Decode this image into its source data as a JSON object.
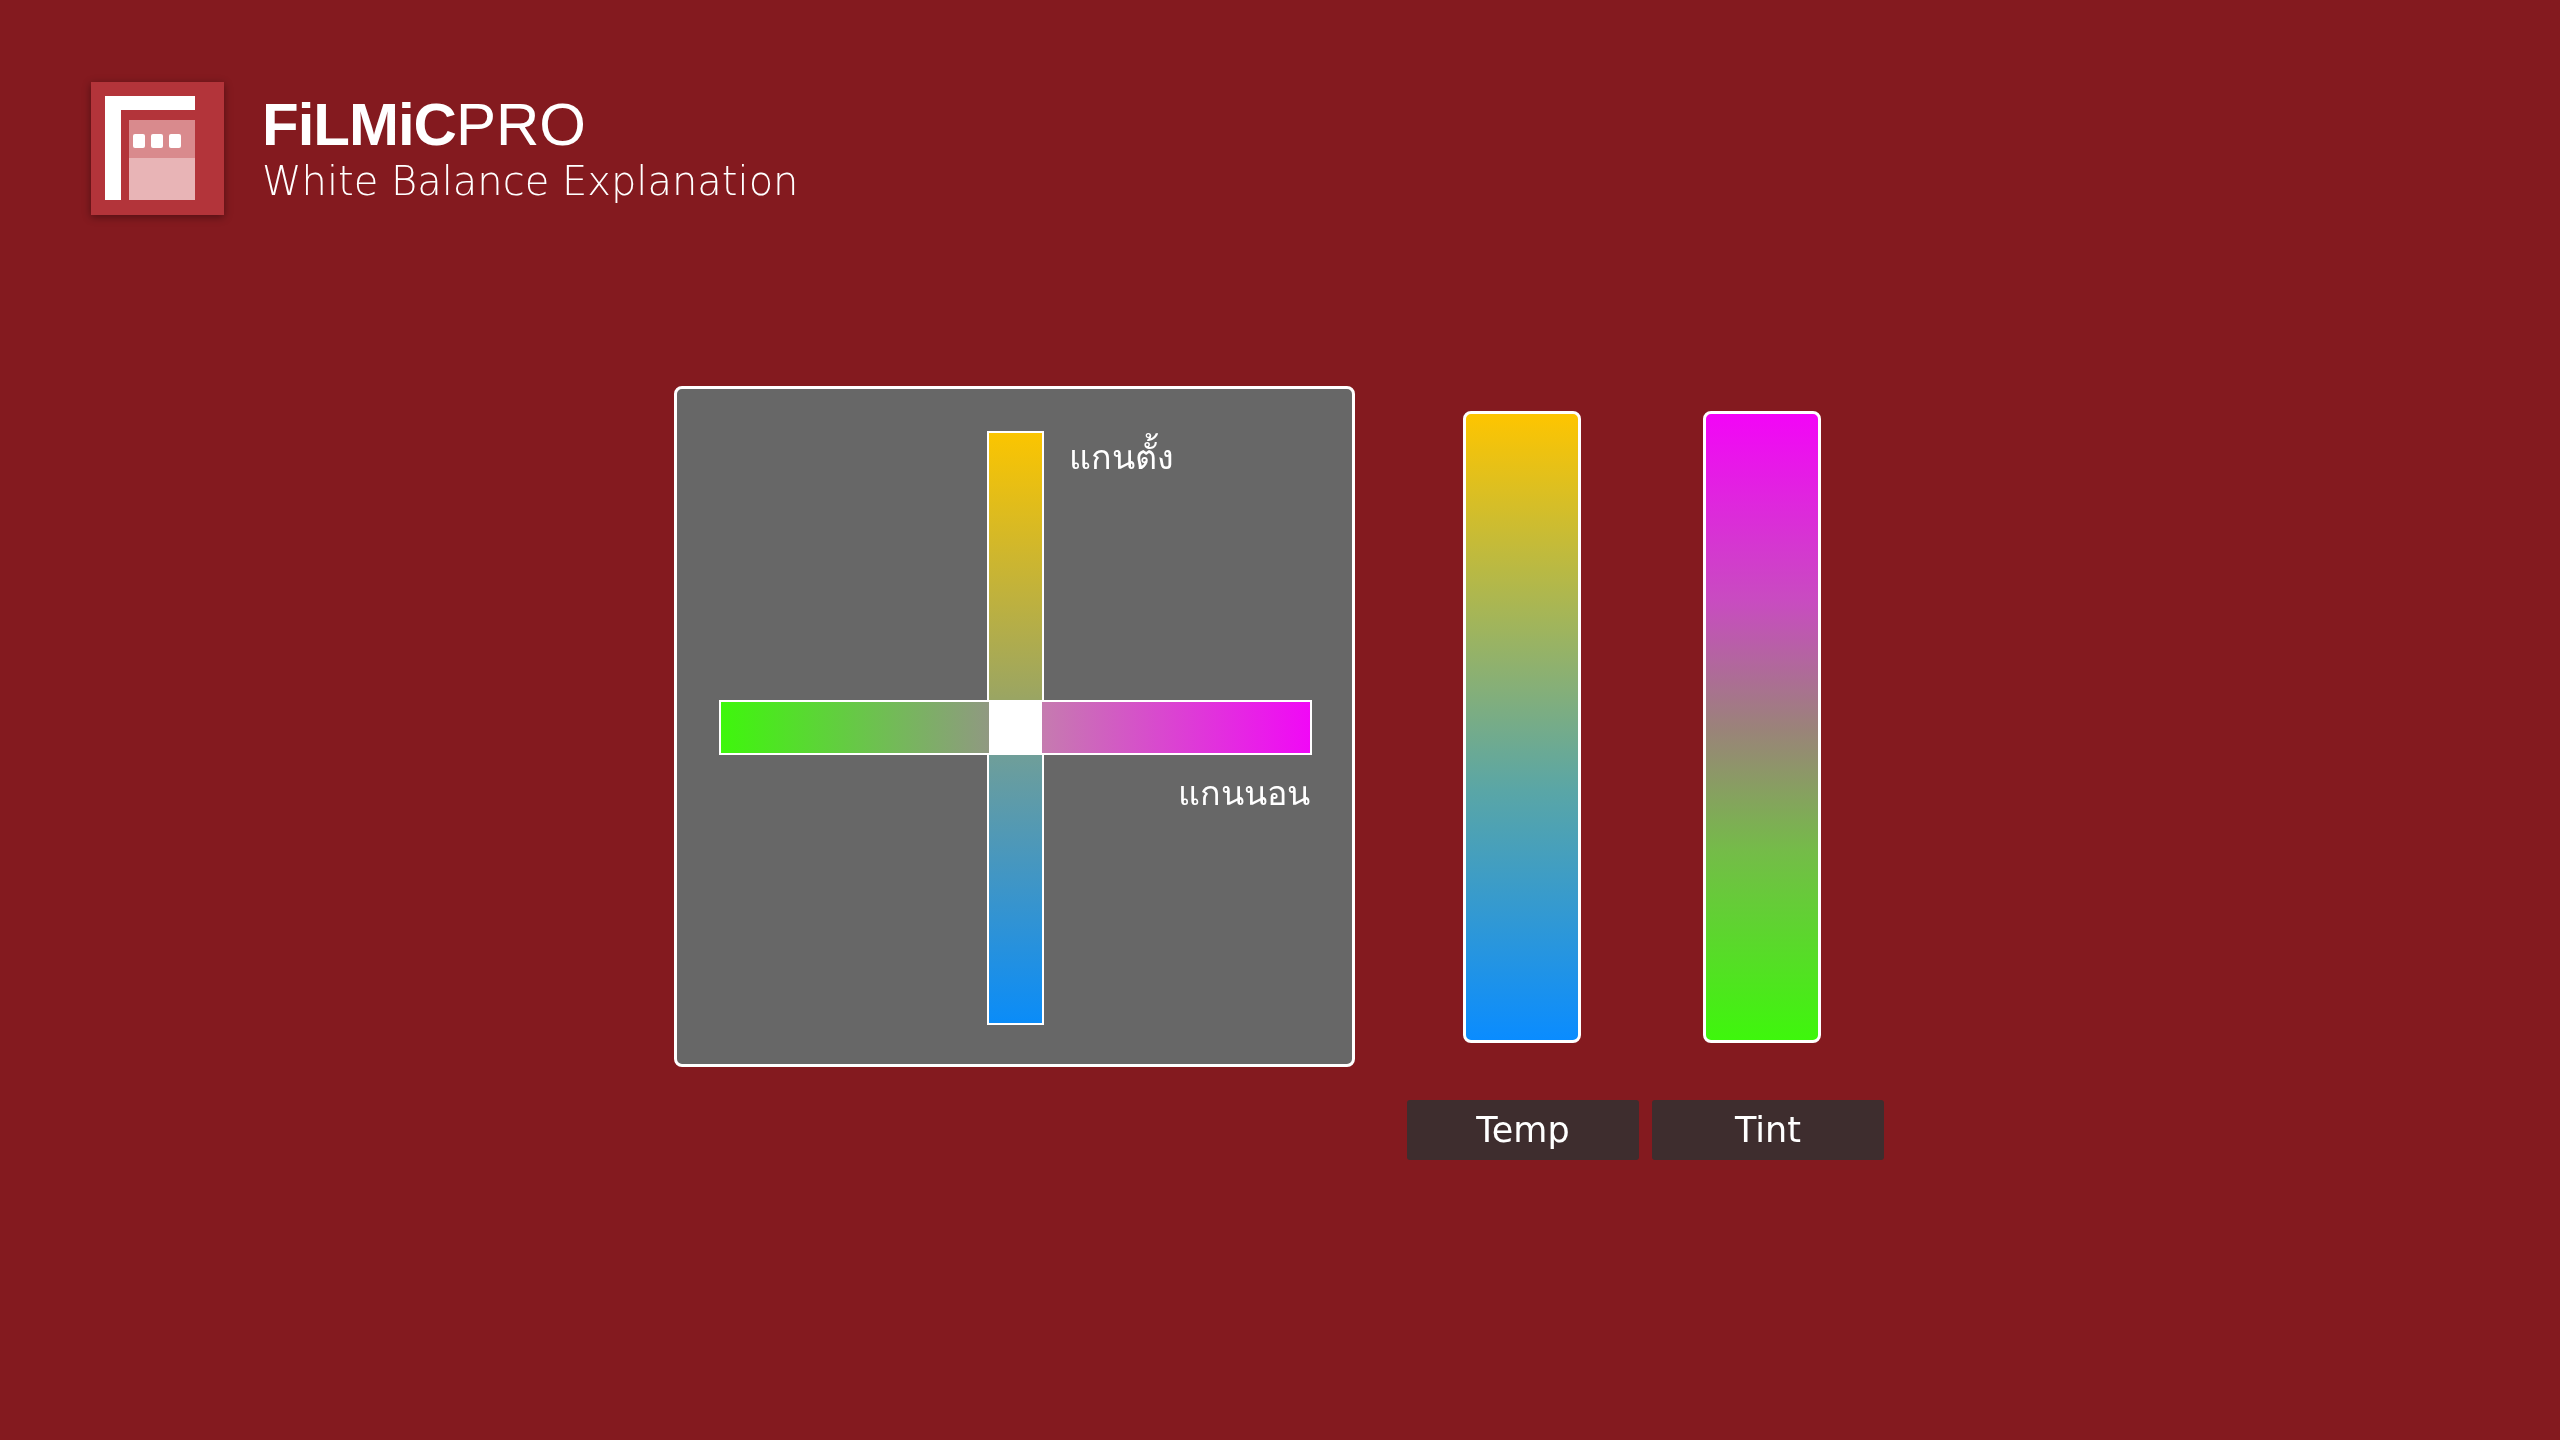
{
  "header": {
    "brand": "FiLMiC",
    "brand_suffix": "PRO",
    "subtitle": "White Balance Explanation"
  },
  "diagram": {
    "vertical_axis_label": "แกนตั้ง",
    "horizontal_axis_label": "แกนนอน"
  },
  "sliders": [
    {
      "kind": "temp",
      "label": "Temp"
    },
    {
      "kind": "tint",
      "label": "Tint"
    }
  ]
}
